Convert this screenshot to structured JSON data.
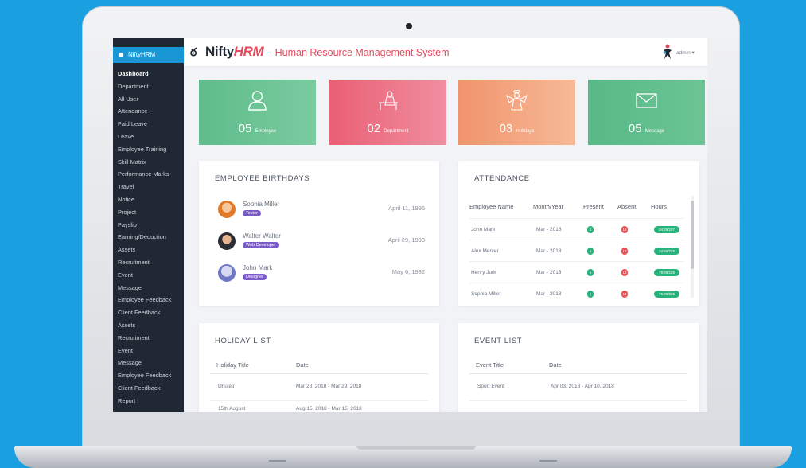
{
  "sidebar": {
    "brand": "NiftyHRM",
    "items": [
      {
        "label": "Dashboard",
        "active": true
      },
      {
        "label": "Department"
      },
      {
        "label": "All User"
      },
      {
        "label": "Attendance"
      },
      {
        "label": "Paid Leave"
      },
      {
        "label": "Leave"
      },
      {
        "label": "Employee Training"
      },
      {
        "label": "Skill Matrix"
      },
      {
        "label": "Performance Marks"
      },
      {
        "label": "Travel"
      },
      {
        "label": "Notice"
      },
      {
        "label": "Project"
      },
      {
        "label": "Payslip"
      },
      {
        "label": "Earning/Deduction"
      },
      {
        "label": "Assets"
      },
      {
        "label": "Recruitment"
      },
      {
        "label": "Event"
      },
      {
        "label": "Message"
      },
      {
        "label": "Employee Feedback"
      },
      {
        "label": "Client Feedback"
      },
      {
        "label": "Assets"
      },
      {
        "label": "Recruitment"
      },
      {
        "label": "Event"
      },
      {
        "label": "Message"
      },
      {
        "label": "Employee Feedback"
      },
      {
        "label": "Client Feedback"
      },
      {
        "label": "Report"
      }
    ]
  },
  "header": {
    "logo_prefix": "Nifty",
    "logo_suffix": "HRM",
    "tagline": "- Human Resource Management System",
    "user": "admin ▾"
  },
  "stats": [
    {
      "num": "05",
      "label": "Employee",
      "icon": "user-icon"
    },
    {
      "num": "02",
      "label": "Department",
      "icon": "desk-worker-icon"
    },
    {
      "num": "03",
      "label": "Holidays",
      "icon": "angel-icon"
    },
    {
      "num": "05",
      "label": "Message",
      "icon": "envelope-icon"
    }
  ],
  "birthdays": {
    "title": "EMPLOYEE BIRTHDAYS",
    "rows": [
      {
        "name": "Sophia Miller",
        "role": "Tester",
        "date": "April 11, 1996"
      },
      {
        "name": "Walter Walter",
        "role": "Web Developer",
        "date": "April 29, 1993"
      },
      {
        "name": "John Mark",
        "role": "Designer",
        "date": "May 6, 1982"
      }
    ]
  },
  "attendance": {
    "title": "ATTENDANCE",
    "columns": [
      "Employee Name",
      "Month/Year",
      "Present",
      "Absent",
      "Hours"
    ],
    "rows": [
      {
        "name": "John Mark",
        "month": "Mar - 2018",
        "present": "0",
        "absent": "16",
        "hours": "04:29/207"
      },
      {
        "name": "Alex Mercer",
        "month": "Mar - 2018",
        "present": "6",
        "absent": "13",
        "hours": "74:59/225"
      },
      {
        "name": "Henry Jurk",
        "month": "Mar - 2018",
        "present": "6",
        "absent": "13",
        "hours": "79:09/225"
      },
      {
        "name": "Sophia Miller",
        "month": "Mar - 2018",
        "present": "6",
        "absent": "14",
        "hours": "75:39/225"
      }
    ]
  },
  "holidays": {
    "title": "HOLIDAY LIST",
    "columns": [
      "Holiday Title",
      "Date"
    ],
    "rows": [
      {
        "title": "Dhuleti",
        "date": "Mar 28, 2018 - Mar 29, 2018"
      },
      {
        "title": "15th August",
        "date": "Aug 15, 2018 - Mar 15, 2018"
      }
    ]
  },
  "events": {
    "title": "EVENT LIST",
    "columns": [
      "Event Title",
      "Date"
    ],
    "rows": [
      {
        "title": "Sport Event",
        "date": "Apr 03, 2018 - Apr 10, 2018"
      }
    ]
  },
  "colors": {
    "background": "#1a9fe0",
    "sidebar": "#1f2833",
    "accent_blue": "#1996d4",
    "brand_red": "#e34a5b",
    "green": "#5fbc8b",
    "pink": "#ea5f74",
    "orange": "#f1946d"
  }
}
